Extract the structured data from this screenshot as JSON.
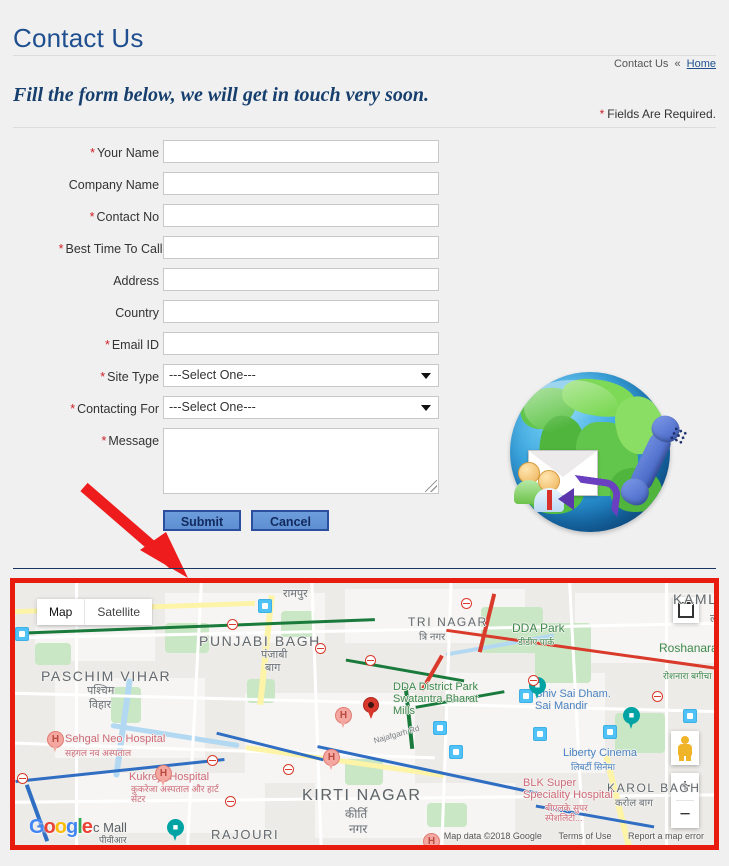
{
  "header": {
    "title": "Contact Us",
    "breadcrumb_current": "Contact Us",
    "breadcrumb_separator": "«",
    "breadcrumb_home": "Home",
    "subtitle": "Fill the form below, we will get in touch very soon.",
    "required_star": "*",
    "required_note": "Fields Are Required."
  },
  "form": {
    "fields": [
      {
        "label": "Your Name :",
        "required": true,
        "type": "text",
        "value": ""
      },
      {
        "label": "Company Name :",
        "required": false,
        "type": "text",
        "value": ""
      },
      {
        "label": "Contact No :",
        "required": true,
        "type": "text",
        "value": ""
      },
      {
        "label": "Best Time To Call:",
        "required": true,
        "type": "text",
        "value": ""
      },
      {
        "label": "Address :",
        "required": false,
        "type": "text",
        "value": ""
      },
      {
        "label": "Country :",
        "required": false,
        "type": "text",
        "value": ""
      },
      {
        "label": "Email ID :",
        "required": true,
        "type": "text",
        "value": ""
      },
      {
        "label": "Site Type :",
        "required": true,
        "type": "select",
        "value": "---Select One---"
      },
      {
        "label": "Contacting For :",
        "required": true,
        "type": "select",
        "value": "---Select One---"
      }
    ],
    "labels": {
      "your_name": "Your Name :",
      "company_name": "Company Name :",
      "contact_no": "Contact No :",
      "best_time": "Best Time To Call:",
      "address": "Address :",
      "country": "Country :",
      "email": "Email ID :",
      "site_type": "Site Type :",
      "contacting_for": "Contacting For :",
      "message": "Message :"
    },
    "select_placeholder": "---Select One---",
    "message_value": "",
    "submit_label": "Submit",
    "cancel_label": "Cancel",
    "star": "*"
  },
  "illustration": {
    "name": "globe-contact-illustration",
    "parts": [
      "globe",
      "telephone-handset",
      "envelope",
      "two-people",
      "curved-arrow"
    ]
  },
  "annotation": {
    "name": "red-arrow-pointing-to-map",
    "color": "#ee1c1c"
  },
  "map": {
    "type_map_label": "Map",
    "type_satellite_label": "Satellite",
    "zoom_in": "+",
    "zoom_out": "−",
    "logo": {
      "g1": "G",
      "o1": "o",
      "o2": "o",
      "g2": "g",
      "l": "l",
      "e": "e"
    },
    "attribution_data": "Map data ©2018 Google",
    "attribution_terms": "Terms of Use",
    "attribution_report": "Report a map error",
    "border_color": "#e81b0f",
    "labels": [
      {
        "text": "PASCHIM VIHAR",
        "sub": "पश्चिम",
        "sub2": "विहार"
      },
      {
        "text": "PUNJABI BAGH",
        "sub": "पंजाबी",
        "sub2": "बाग"
      },
      {
        "text": "TRI NAGAR",
        "sub": "त्रि नगर"
      },
      {
        "text": "KAMLA",
        "sub": "ला"
      },
      {
        "text": "KIRTI NAGAR",
        "sub": "कीर्ति",
        "sub2": "नगर"
      },
      {
        "text": "KAROL BAGH",
        "sub": "करोल बाग"
      },
      {
        "text": "रामपुर",
        "sub": ""
      },
      {
        "text": "RAJOURI",
        "sub": ""
      }
    ],
    "pois": [
      {
        "text": "DDA Park",
        "sub": "डीडीए पार्क",
        "kind": "park"
      },
      {
        "text": "Roshanara Garden",
        "sub": "रोशनारा बगीचा",
        "kind": "park"
      },
      {
        "text": "DDA District Park Swatantra Bharat Mills",
        "sub": "",
        "kind": "park"
      },
      {
        "text": "Shiv Sai Dham. Sai Mandir",
        "sub": "",
        "kind": "poi"
      },
      {
        "text": "Liberty Cinema",
        "sub": "लिबर्टी सिनेमा",
        "kind": "poi"
      },
      {
        "text": "Sehgal Neo Hospital",
        "sub": "सहगल नव अस्पताल",
        "kind": "med"
      },
      {
        "text": "Kukreja Hospital",
        "sub": "कुकरेजा अस्पताल और हार्ट सेंटर",
        "kind": "med"
      },
      {
        "text": "BLK Super Speciality Hospital",
        "sub": "बीएलके सुपर स्पेशलिटी...",
        "kind": "med"
      },
      {
        "text": "c Mall",
        "sub": "पीवीआर",
        "kind": "poi"
      },
      {
        "text": "Najafgarh Rd",
        "sub": "",
        "kind": "road"
      }
    ]
  }
}
